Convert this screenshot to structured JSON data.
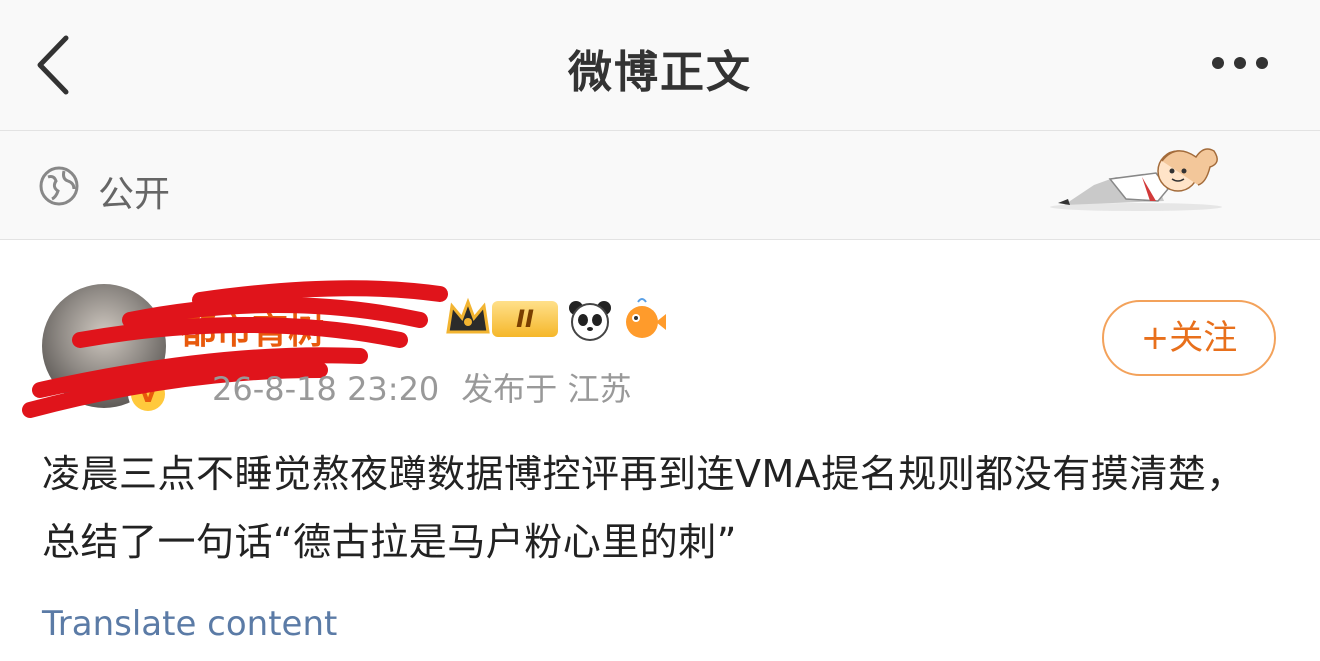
{
  "header": {
    "title": "微博正文"
  },
  "visibility": {
    "label": "公开"
  },
  "post": {
    "author": {
      "name": "都市育树",
      "level": "II"
    },
    "timestamp": "26-8-18 23:20",
    "location": "发布于 江苏",
    "follow_label": "+关注",
    "text": "凌晨三点不睡觉熬夜蹲数据博控评再到连VMA提名规则都没有摸清楚，总结了一句话“德古拉是马户粉心里的刺”",
    "translate_label": "Translate content"
  },
  "colors": {
    "accent": "#e8701c",
    "link": "#5b7ba6",
    "redaction": "#e0141b"
  }
}
